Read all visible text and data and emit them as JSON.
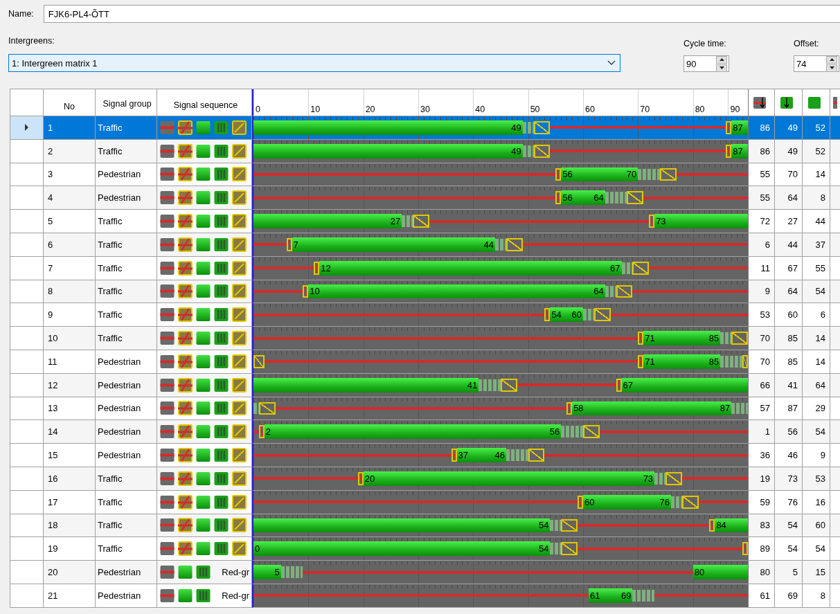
{
  "name_field": {
    "label": "Name:",
    "value": "FJK6-PL4-ÕTT"
  },
  "intergreens": {
    "label": "Intergreens:",
    "value": "1: Intergreen matrix 1"
  },
  "cycle_time": {
    "label": "Cycle time:",
    "value": "90"
  },
  "offset": {
    "label": "Offset:",
    "value": "74"
  },
  "table": {
    "columns": [
      "No",
      "Signal group",
      "Signal sequence"
    ],
    "timeline_ticks": [
      "0",
      "10",
      "20",
      "30",
      "40",
      "50",
      "60",
      "70",
      "80",
      "90"
    ],
    "rows": [
      {
        "no": "1",
        "signal_group": "Traffic",
        "kind": "vehicle",
        "selected": true,
        "markers": [
          {
            "kind": "green_end",
            "label": "49"
          },
          {
            "kind": "green_start",
            "label": "87"
          }
        ],
        "col_1": "86",
        "col_2": "49",
        "col_3": "52"
      },
      {
        "no": "2",
        "signal_group": "Traffic",
        "kind": "vehicle",
        "selected": false,
        "markers": [
          {
            "kind": "green_end",
            "label": "49"
          },
          {
            "kind": "green_start",
            "label": "87"
          }
        ],
        "col_1": "86",
        "col_2": "49",
        "col_3": "52"
      },
      {
        "no": "3",
        "signal_group": "Pedestrian",
        "kind": "pedestrian",
        "selected": false,
        "markers": [
          {
            "kind": "green_start",
            "label": "56"
          },
          {
            "kind": "green_end",
            "label": "70"
          }
        ],
        "col_1": "55",
        "col_2": "70",
        "col_3": "14"
      },
      {
        "no": "4",
        "signal_group": "Pedestrian",
        "kind": "pedestrian",
        "selected": false,
        "markers": [
          {
            "kind": "green_start",
            "label": "56"
          },
          {
            "kind": "green_end",
            "label": "64"
          }
        ],
        "col_1": "55",
        "col_2": "64",
        "col_3": "8"
      },
      {
        "no": "5",
        "signal_group": "Traffic",
        "kind": "vehicle",
        "selected": false,
        "markers": [
          {
            "kind": "green_end",
            "label": "27"
          },
          {
            "kind": "green_start",
            "label": "73"
          }
        ],
        "col_1": "72",
        "col_2": "27",
        "col_3": "44"
      },
      {
        "no": "6",
        "signal_group": "Traffic",
        "kind": "vehicle",
        "selected": false,
        "markers": [
          {
            "kind": "green_start",
            "label": "7"
          },
          {
            "kind": "green_end",
            "label": "44"
          }
        ],
        "col_1": "6",
        "col_2": "44",
        "col_3": "37"
      },
      {
        "no": "7",
        "signal_group": "Traffic",
        "kind": "vehicle",
        "selected": false,
        "markers": [
          {
            "kind": "green_start",
            "label": "12"
          },
          {
            "kind": "green_end",
            "label": "67"
          }
        ],
        "col_1": "11",
        "col_2": "67",
        "col_3": "55"
      },
      {
        "no": "8",
        "signal_group": "Traffic",
        "kind": "vehicle",
        "selected": false,
        "markers": [
          {
            "kind": "green_start",
            "label": "10"
          },
          {
            "kind": "green_end",
            "label": "64"
          }
        ],
        "col_1": "9",
        "col_2": "64",
        "col_3": "54"
      },
      {
        "no": "9",
        "signal_group": "Traffic",
        "kind": "vehicle",
        "selected": false,
        "markers": [
          {
            "kind": "green_start",
            "label": "54"
          },
          {
            "kind": "green_end",
            "label": "60"
          }
        ],
        "col_1": "53",
        "col_2": "60",
        "col_3": "6"
      },
      {
        "no": "10",
        "signal_group": "Traffic",
        "kind": "vehicle",
        "selected": false,
        "markers": [
          {
            "kind": "green_start",
            "label": "71"
          },
          {
            "kind": "green_end",
            "label": "85"
          }
        ],
        "col_1": "70",
        "col_2": "85",
        "col_3": "14"
      },
      {
        "no": "11",
        "signal_group": "Pedestrian",
        "kind": "pedestrian",
        "selected": false,
        "markers": [
          {
            "kind": "green_start",
            "label": "71"
          },
          {
            "kind": "green_end",
            "label": "85"
          }
        ],
        "col_1": "70",
        "col_2": "85",
        "col_3": "14"
      },
      {
        "no": "12",
        "signal_group": "Pedestrian",
        "kind": "pedestrian",
        "selected": false,
        "markers": [
          {
            "kind": "green_end",
            "label": "41"
          },
          {
            "kind": "green_start",
            "label": "67"
          }
        ],
        "col_1": "66",
        "col_2": "41",
        "col_3": "64"
      },
      {
        "no": "13",
        "signal_group": "Pedestrian",
        "kind": "pedestrian",
        "selected": false,
        "markers": [
          {
            "kind": "green_start",
            "label": "58"
          },
          {
            "kind": "green_end",
            "label": "87"
          }
        ],
        "col_1": "57",
        "col_2": "87",
        "col_3": "29"
      },
      {
        "no": "14",
        "signal_group": "Pedestrian",
        "kind": "pedestrian",
        "selected": false,
        "markers": [
          {
            "kind": "green_start",
            "label": "2"
          },
          {
            "kind": "green_end",
            "label": "56"
          }
        ],
        "col_1": "1",
        "col_2": "56",
        "col_3": "54"
      },
      {
        "no": "15",
        "signal_group": "Pedestrian",
        "kind": "pedestrian",
        "selected": false,
        "markers": [
          {
            "kind": "green_start",
            "label": "37"
          },
          {
            "kind": "green_end",
            "label": "46"
          }
        ],
        "col_1": "36",
        "col_2": "46",
        "col_3": "9"
      },
      {
        "no": "16",
        "signal_group": "Traffic",
        "kind": "vehicle",
        "selected": false,
        "markers": [
          {
            "kind": "green_start",
            "label": "20"
          },
          {
            "kind": "green_end",
            "label": "73"
          }
        ],
        "col_1": "19",
        "col_2": "73",
        "col_3": "53"
      },
      {
        "no": "17",
        "signal_group": "Traffic",
        "kind": "vehicle",
        "selected": false,
        "markers": [
          {
            "kind": "green_start",
            "label": "60"
          },
          {
            "kind": "green_end",
            "label": "76"
          }
        ],
        "col_1": "59",
        "col_2": "76",
        "col_3": "16"
      },
      {
        "no": "18",
        "signal_group": "Traffic",
        "kind": "vehicle",
        "selected": false,
        "markers": [
          {
            "kind": "green_end",
            "label": "54"
          },
          {
            "kind": "green_start",
            "label": "84"
          }
        ],
        "col_1": "83",
        "col_2": "54",
        "col_3": "60"
      },
      {
        "no": "19",
        "signal_group": "Traffic",
        "kind": "vehicle",
        "selected": false,
        "markers": [
          {
            "kind": "green_start",
            "label": "0"
          },
          {
            "kind": "green_end",
            "label": "54"
          }
        ],
        "col_1": "89",
        "col_2": "54",
        "col_3": "54"
      },
      {
        "no": "20",
        "signal_group": "Pedestrian",
        "kind": "pedestrian_red_green",
        "sequence_label": "Red-gr",
        "selected": false,
        "markers": [
          {
            "kind": "green_end",
            "label": "5"
          },
          {
            "kind": "green_start",
            "label": "80"
          }
        ],
        "col_1": "80",
        "col_2": "5",
        "col_3": "15"
      },
      {
        "no": "21",
        "signal_group": "Pedestrian",
        "kind": "pedestrian_red_green",
        "sequence_label": "Red-gr",
        "selected": false,
        "markers": [
          {
            "kind": "green_start",
            "label": "61"
          },
          {
            "kind": "green_end",
            "label": "69"
          }
        ],
        "col_1": "61",
        "col_2": "69",
        "col_3": "8"
      }
    ]
  }
}
